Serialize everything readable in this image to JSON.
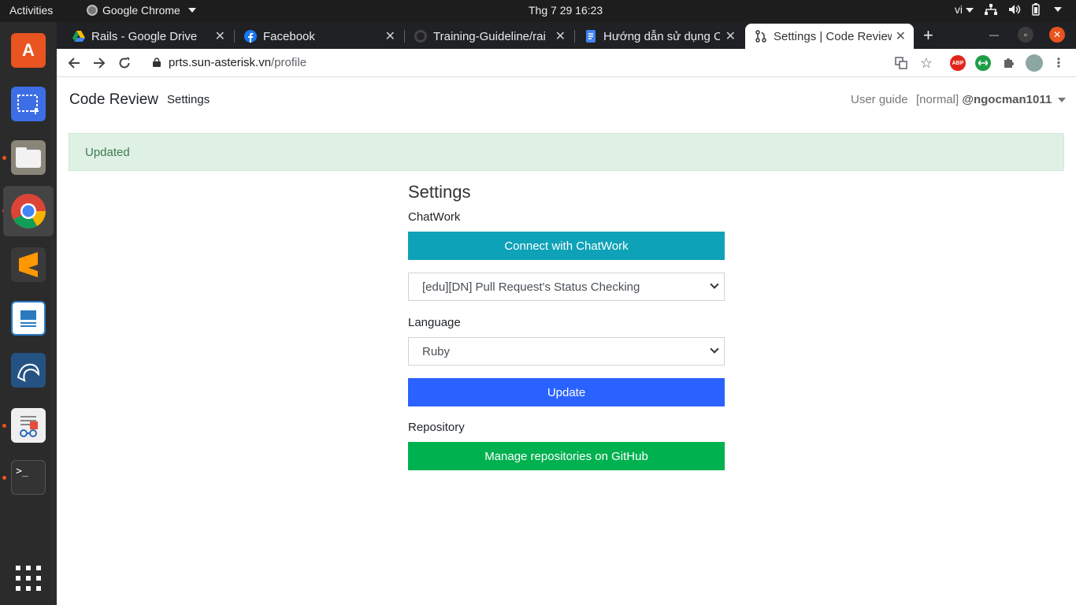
{
  "system_bar": {
    "activities": "Activities",
    "app_name": "Google Chrome",
    "clock": "Thg 7 29  16:23",
    "language": "vi"
  },
  "browser": {
    "tabs": [
      {
        "title": "Rails - Google Drive",
        "icon": "google-drive-icon"
      },
      {
        "title": "Facebook",
        "icon": "facebook-icon"
      },
      {
        "title": "Training-Guideline/rai",
        "icon": "github-icon"
      },
      {
        "title": "Hướng dẫn sử dụng C",
        "icon": "google-docs-icon"
      },
      {
        "title": "Settings | Code Review",
        "icon": "pull-request-icon",
        "active": true
      }
    ],
    "url_host": "prts.sun-asterisk.vn",
    "url_path": "/profile",
    "extensions": [
      "translate-icon",
      "star-icon",
      "adblock-icon",
      "green-extension-icon",
      "puzzle-icon",
      "profile-avatar",
      "menu-icon"
    ],
    "abp_label": "ABP"
  },
  "navbar": {
    "brand": "Code Review",
    "settings_link": "Settings",
    "user_guide": "User guide",
    "user_role": "[normal]",
    "username": "@ngocman1011"
  },
  "alert": {
    "message": "Updated"
  },
  "settings": {
    "title": "Settings",
    "chatwork_label": "ChatWork",
    "connect_button": "Connect with ChatWork",
    "room_select_value": "[edu][DN] Pull Request's Status Checking",
    "language_label": "Language",
    "language_select_value": "Ruby",
    "update_button": "Update",
    "repository_label": "Repository",
    "github_button": "Manage repositories on GitHub"
  },
  "colors": {
    "chatwork": "#0ea2b8",
    "update": "#2962ff",
    "github": "#00b14f",
    "alert_bg": "#dff0e4"
  }
}
